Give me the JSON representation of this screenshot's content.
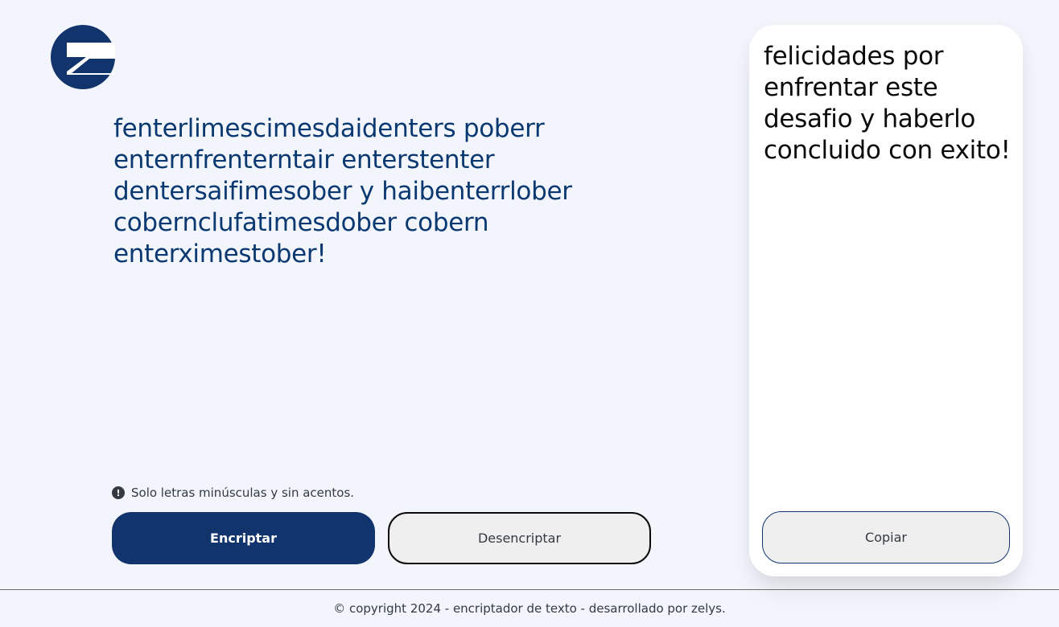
{
  "logo": {
    "name": "z-logo-icon",
    "color": "#12346c"
  },
  "input": {
    "value": "fenterlimescimesdaidenters poberr enternfrenterntair enterstenter dentersaifimesober y haibenterrlober cobernclufatimesdober cobern enterximestober!"
  },
  "hint": {
    "icon": "exclamation-circle-icon",
    "icon_glyph": "!",
    "text": "Solo letras minúsculas y sin acentos."
  },
  "buttons": {
    "encrypt_label": "Encriptar",
    "decrypt_label": "Desencriptar",
    "copy_label": "Copiar"
  },
  "output": {
    "text": "felicidades por enfrentar este desafio y haberlo concluido con exito!"
  },
  "footer": {
    "text": "© copyright 2024 - encriptador de texto - desarrollado por zelys."
  },
  "colors": {
    "background": "#f3f5fc",
    "primary": "#12346c",
    "input_text": "#0a3871",
    "button_secondary": "#efefef"
  }
}
